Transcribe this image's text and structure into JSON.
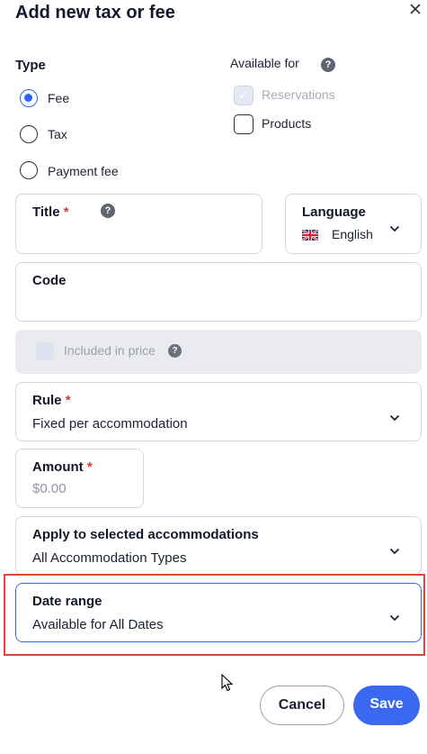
{
  "header": {
    "title": "Add new tax or fee"
  },
  "type_section": {
    "label": "Type",
    "options": [
      {
        "label": "Fee",
        "checked": true
      },
      {
        "label": "Tax",
        "checked": false
      },
      {
        "label": "Payment fee",
        "checked": false
      }
    ]
  },
  "available_section": {
    "label": "Available for",
    "options": [
      {
        "label": "Reservations",
        "checked": true,
        "disabled": true
      },
      {
        "label": "Products",
        "checked": false,
        "disabled": false
      }
    ]
  },
  "fields": {
    "title": {
      "label": "Title",
      "required_mark": "*",
      "value": ""
    },
    "language": {
      "label": "Language",
      "value": "English"
    },
    "code": {
      "label": "Code",
      "value": ""
    },
    "included_in_price": {
      "label": "Included in price"
    },
    "rule": {
      "label": "Rule",
      "required_mark": "*",
      "value": "Fixed per accommodation"
    },
    "amount": {
      "label": "Amount",
      "required_mark": "*",
      "placeholder": "$0.00"
    },
    "apply_to": {
      "label": "Apply to selected accommodations",
      "value": "All Accommodation Types"
    },
    "date_range": {
      "label": "Date range",
      "value": "Available for All Dates"
    }
  },
  "footer": {
    "cancel_label": "Cancel",
    "save_label": "Save"
  },
  "colors": {
    "accent": "#3a68f0",
    "highlight": "#e2443c",
    "required": "#e0352b"
  }
}
